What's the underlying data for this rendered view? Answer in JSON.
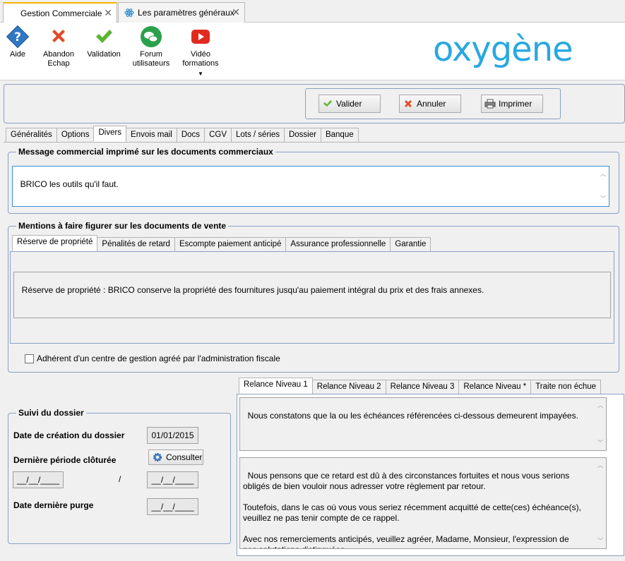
{
  "doc_tabs": [
    {
      "label": "Gestion Commerciale"
    },
    {
      "label": "Les paramètres généraux"
    }
  ],
  "ribbon": {
    "aide": "Aide",
    "abandon_1": "Abandon",
    "abandon_2": "Echap",
    "validation": "Validation",
    "forum_1": "Forum",
    "forum_2": "utilisateurs",
    "video_1": "Vidéo",
    "video_2": "formations"
  },
  "brand": {
    "logo_text": "oxygène",
    "color": "#29a8e0"
  },
  "actions": {
    "valider": "Valider",
    "annuler": "Annuler",
    "imprimer": "Imprimer"
  },
  "main_tabs": [
    "Généralités",
    "Options",
    "Divers",
    "Envois mail",
    "Docs",
    "CGV",
    "Lots / séries",
    "Dossier",
    "Banque"
  ],
  "message_section": {
    "title": "Message commercial imprimé sur les documents commerciaux",
    "value": "BRICO les outils qu'il faut."
  },
  "mentions_section": {
    "title": "Mentions à faire figurer sur les documents de vente",
    "tabs": [
      "Réserve de propriété",
      "Pénalités de retard",
      "Escompte paiement anticipé",
      "Assurance professionnelle",
      "Garantie"
    ],
    "value": "Réserve de propriété : BRICO conserve la propriété des fournitures jusqu'au paiement intégral du prix et des frais annexes.",
    "checkbox_label": "Adhérent d'un centre de gestion agréé par l'administration fiscale"
  },
  "suivi": {
    "title": "Suivi du dossier",
    "creation_label": "Date de création du dossier",
    "creation_value": "01/01/2015",
    "periode_label": "Dernière période clôturée",
    "consulter": "Consulter",
    "empty_date": "__/__/____",
    "separator": "/",
    "purge_label": "Date dernière purge"
  },
  "relance": {
    "tabs": [
      "Relance Niveau 1",
      "Relance Niveau 2",
      "Relance Niveau 3",
      "Relance Niveau *",
      "Traite non échue"
    ],
    "text1": "Nous constatons que la ou les échéances référencées ci-dessous demeurent impayées.",
    "text2": "Nous pensons que ce retard est dû à des circonstances fortuites et nous vous serions\nobligés de bien vouloir nous adresser votre règlement par retour.\n\nToutefois, dans le cas où vous vous seriez récemment acquitté de cette(ces) échéance(s),\nveuillez ne pas tenir compte de ce rappel.\n\nAvec nos remerciements anticipés, veuillez agréer, Madame, Monsieur, l'expression de\nnos salutations distinguées."
  }
}
